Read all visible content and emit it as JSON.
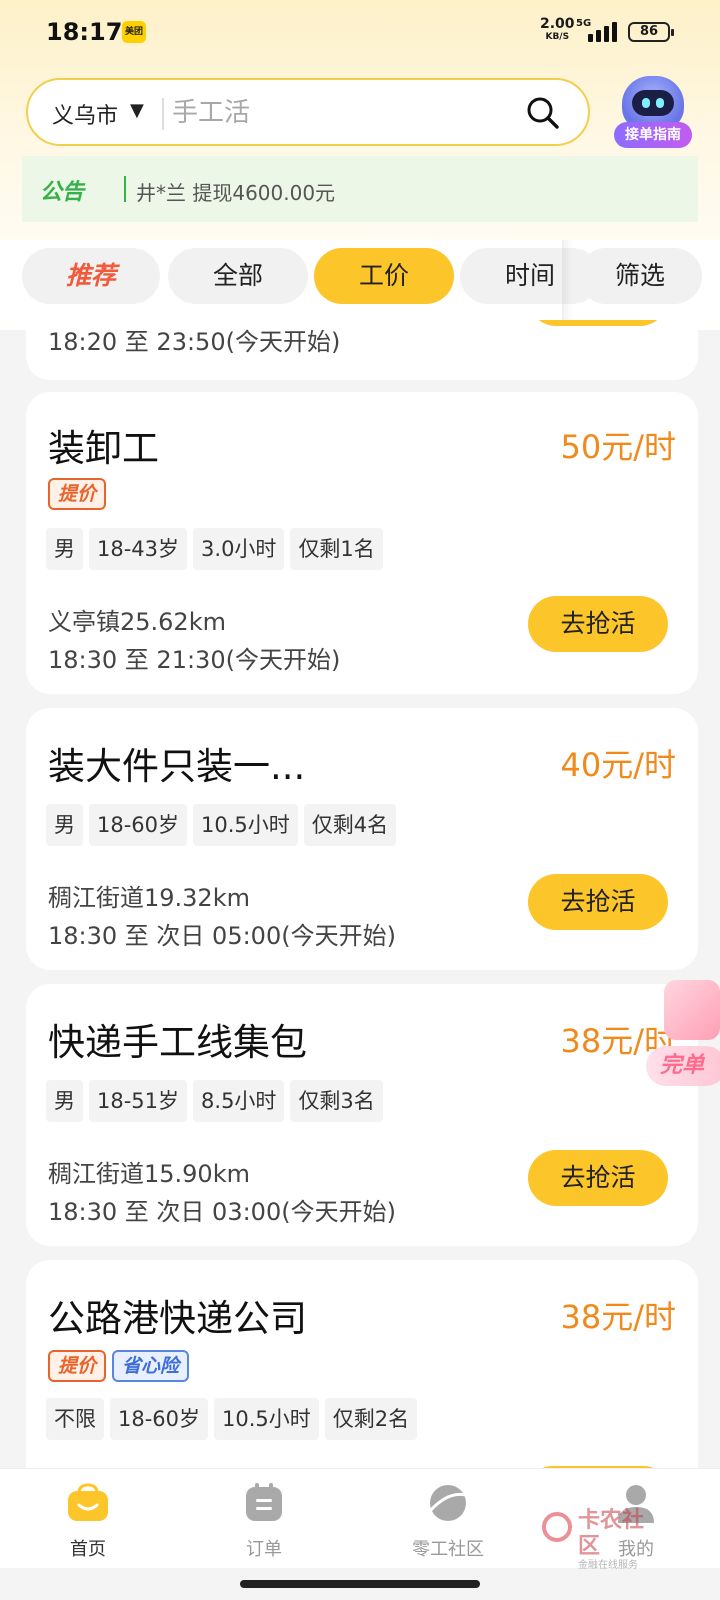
{
  "status_bar": {
    "time": "18:17",
    "app_badge": "美团",
    "net_speed": "2.00",
    "net_unit": "KB/S",
    "network": "5G",
    "battery": "86"
  },
  "search": {
    "city": "义乌市",
    "placeholder": "手工活"
  },
  "guide": {
    "label": "接单指南"
  },
  "notice": {
    "tag": "公告",
    "text": "井*兰 提现4600.00元"
  },
  "tabs": [
    {
      "label": "推荐"
    },
    {
      "label": "全部"
    },
    {
      "label": "工价",
      "active": true
    },
    {
      "label": "时间"
    },
    {
      "label": "筛选"
    }
  ],
  "partial_card": {
    "time": "18:20 至 23:50(今天开始)"
  },
  "jobs": [
    {
      "title": "装卸工",
      "price": "50元/时",
      "badges": [
        "提价"
      ],
      "tags": [
        "男",
        "18-43岁",
        "3.0小时",
        "仅剩1名"
      ],
      "location": "义亭镇25.62km",
      "time": "18:30 至 21:30(今天开始)",
      "button": "去抢活"
    },
    {
      "title": "装大件只装一...",
      "price": "40元/时",
      "badges": [],
      "tags": [
        "男",
        "18-60岁",
        "10.5小时",
        "仅剩4名"
      ],
      "location": "稠江街道19.32km",
      "time": "18:30 至 次日 05:00(今天开始)",
      "button": "去抢活"
    },
    {
      "title": "快递手工线集包",
      "price": "38元/时",
      "badges": [],
      "tags": [
        "男",
        "18-51岁",
        "8.5小时",
        "仅剩3名"
      ],
      "location": "稠江街道15.90km",
      "time": "18:30 至 次日 03:00(今天开始)",
      "button": "去抢活"
    },
    {
      "title": "公路港快递公司",
      "price": "38元/时",
      "badges": [
        "提价",
        "省心险"
      ],
      "tags": [
        "不限",
        "18-60岁",
        "10.5小时",
        "仅剩2名"
      ]
    }
  ],
  "promo": {
    "label": "完单"
  },
  "bottom_nav": [
    {
      "label": "首页",
      "icon": "home-bag-icon",
      "active": true
    },
    {
      "label": "订单",
      "icon": "order-icon"
    },
    {
      "label": "零工社区",
      "icon": "community-planet-icon"
    },
    {
      "label": "我的",
      "icon": "profile-icon"
    }
  ],
  "watermark": {
    "title": "卡农社区",
    "subtitle": "金融在线服务"
  },
  "colors": {
    "accent": "#fcc52a",
    "price": "#f18a1c",
    "notice_green": "#36b14a"
  }
}
